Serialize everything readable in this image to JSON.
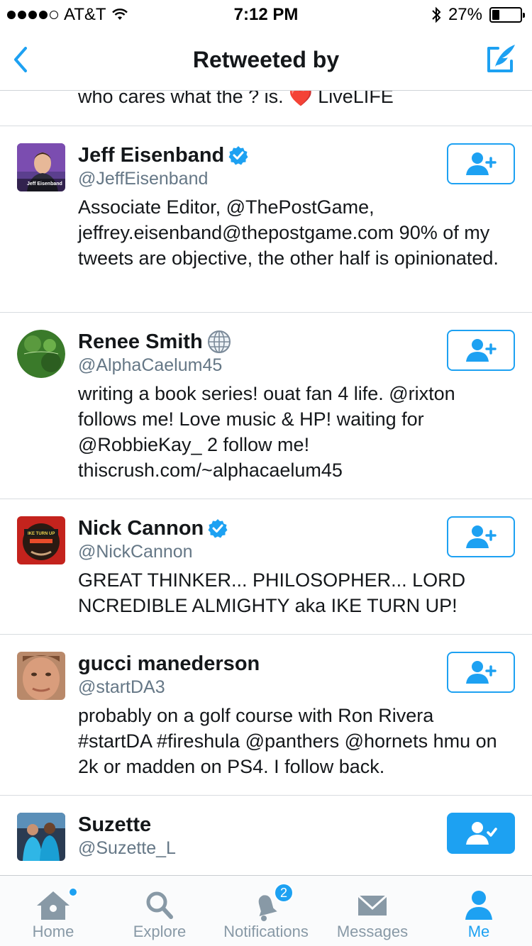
{
  "status_bar": {
    "carrier": "AT&T",
    "time": "7:12 PM",
    "battery": "27%",
    "battery_level": 0.27
  },
  "nav": {
    "title": "Retweeted by"
  },
  "partial_row": {
    "text": "who cares what the ? is. ❤️ LiveLIFE"
  },
  "users": [
    {
      "name": "Jeff Eisenband",
      "handle": "@JeffEisenband",
      "verified": true,
      "bio": "Associate Editor, @ThePostGame, jeffrey.eisenband@thepostgame.com 90% of my tweets are objective, the other half is opinionated.",
      "following": false,
      "avatar_text": "Jeff Eisenband"
    },
    {
      "name": "Renee Smith",
      "handle": "@AlphaCaelum45",
      "verified": false,
      "bio": "writing a book series! ouat fan 4 life. @rixton follows me! Love music & HP! waiting for @RobbieKay_ 2 follow me! thiscrush.com/~alphacaelum45",
      "following": false
    },
    {
      "name": "Nick Cannon",
      "handle": "@NickCannon",
      "verified": true,
      "bio": "GREAT THINKER... PHILOSOPHER... LORD NCREDIBLE ALMIGHTY aka IKE TURN UP!",
      "following": false,
      "avatar_text": "IKE TURN UP"
    },
    {
      "name": "gucci manederson",
      "handle": "@startDA3",
      "verified": false,
      "bio": "probably on a golf course with Ron Rivera #startDA #fireshula @panthers @hornets hmu on 2k or madden on PS4. I follow back.",
      "following": false
    },
    {
      "name": "Suzette",
      "handle": "@Suzette_L",
      "verified": false,
      "bio": "",
      "following": true
    }
  ],
  "tabs": [
    {
      "label": "Home",
      "icon": "home-icon"
    },
    {
      "label": "Explore",
      "icon": "search-icon"
    },
    {
      "label": "Notifications",
      "icon": "bell-icon",
      "badge": "2"
    },
    {
      "label": "Messages",
      "icon": "envelope-icon"
    },
    {
      "label": "Me",
      "icon": "person-icon",
      "active": true
    }
  ],
  "colors": {
    "accent": "#1da1f2",
    "text": "#14171a",
    "secondary": "#657786",
    "tab_inactive": "#8899a6"
  }
}
